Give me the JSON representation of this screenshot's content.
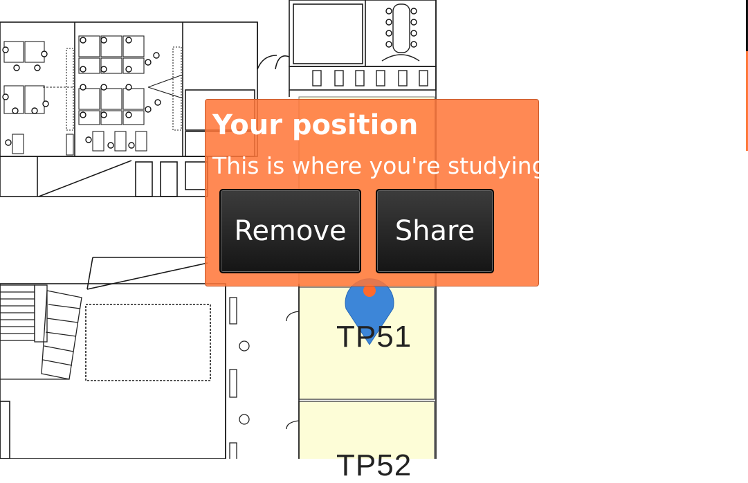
{
  "map": {
    "rooms": [
      {
        "id": "tp51",
        "label": "TP51"
      },
      {
        "id": "tp52",
        "label": "TP52"
      }
    ],
    "colors": {
      "room_fill": "#fdfdd7",
      "line": "#1a1a1a",
      "marker": "#3d86d8",
      "marker_dot": "#ff6a2c"
    }
  },
  "popup": {
    "title": "Your position",
    "subtitle": "This is where you're studying",
    "remove_label": "Remove",
    "share_label": "Share",
    "background": "#ff7638"
  }
}
